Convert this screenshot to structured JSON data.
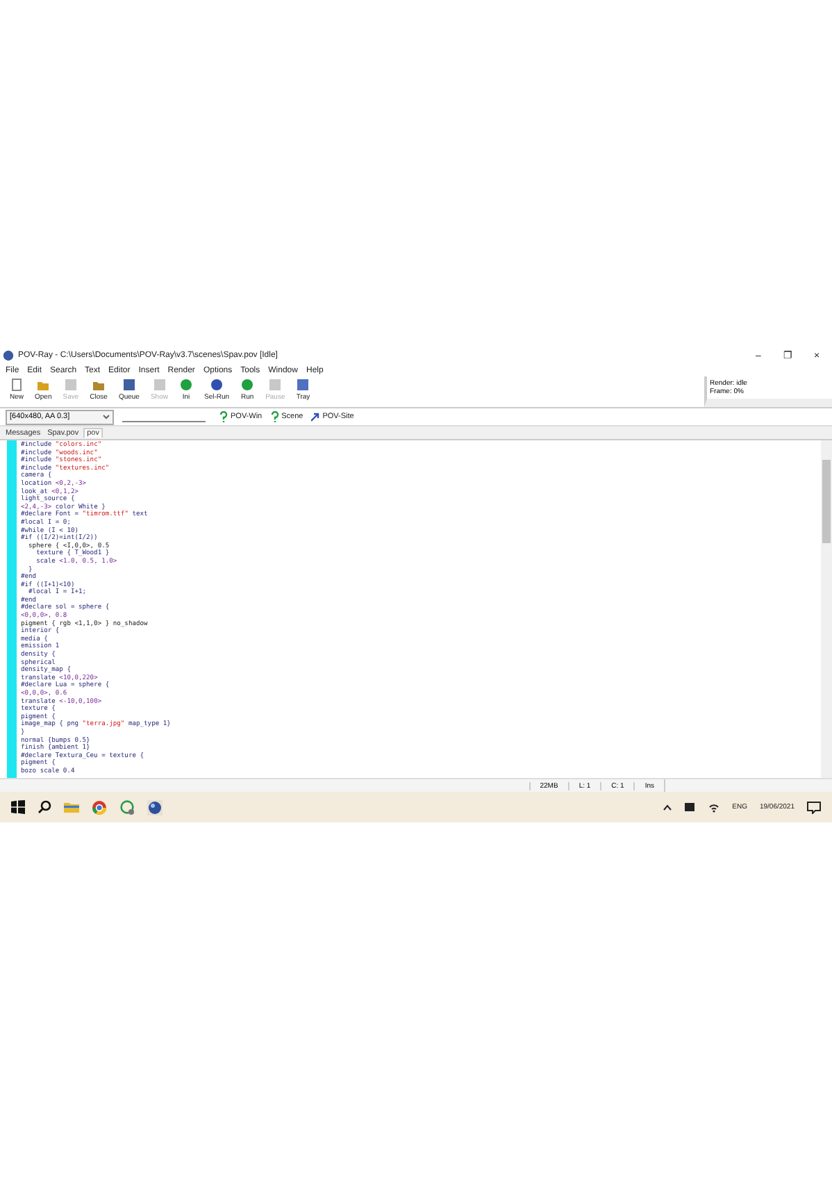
{
  "window": {
    "title": "POV-Ray - C:\\Users\\Documents\\POV-Ray\\v3.7\\scenes\\Spav.pov [Idle]",
    "controls": [
      "–",
      "❐",
      "×"
    ]
  },
  "menu": [
    "File",
    "Edit",
    "Search",
    "Text",
    "Editor",
    "Insert",
    "Render",
    "Options",
    "Tools",
    "Window",
    "Help"
  ],
  "toolbar": [
    {
      "label": "New",
      "kind": "new",
      "disabled": false
    },
    {
      "label": "Open",
      "kind": "open",
      "disabled": false
    },
    {
      "label": "Save",
      "kind": "save",
      "disabled": true
    },
    {
      "label": "Close",
      "kind": "close",
      "disabled": false
    },
    {
      "label": "Queue",
      "kind": "queue",
      "disabled": false
    },
    {
      "label": "Show",
      "kind": "show",
      "disabled": true
    },
    {
      "label": "Ini",
      "kind": "ini",
      "disabled": false
    },
    {
      "label": "Sel-Run",
      "kind": "selrun",
      "disabled": false
    },
    {
      "label": "Run",
      "kind": "run",
      "disabled": false
    },
    {
      "label": "Pause",
      "kind": "pause",
      "disabled": true
    },
    {
      "label": "Tray",
      "kind": "tray",
      "disabled": false
    }
  ],
  "status_panel": [
    "Render: idle",
    "Frame: 0%"
  ],
  "resolution": {
    "value": "[640x480, AA 0.3]"
  },
  "help_links": [
    {
      "label": "POV-Win",
      "kind": "question"
    },
    {
      "label": "Scene",
      "kind": "question"
    },
    {
      "label": "POV-Site",
      "kind": "link"
    }
  ],
  "tabs": [
    {
      "label": "Messages",
      "selected": false
    },
    {
      "label": "Spav.pov",
      "selected": false
    },
    {
      "label": "pov",
      "selected": true
    }
  ],
  "code": [
    [
      {
        "t": "#include ",
        "kind": "kw"
      },
      {
        "t": "\"colors.inc\"",
        "kind": "str"
      }
    ],
    [
      {
        "t": "#include ",
        "kind": "kw"
      },
      {
        "t": "\"woods.inc\"",
        "kind": "str"
      }
    ],
    [
      {
        "t": "#include ",
        "kind": "kw"
      },
      {
        "t": "\"stones.inc\"",
        "kind": "str"
      }
    ],
    [
      {
        "t": "#include ",
        "kind": "kw"
      },
      {
        "t": "\"textures.inc\"",
        "kind": "str"
      }
    ],
    [
      {
        "t": "camera {",
        "kind": "kw"
      }
    ],
    [
      {
        "t": "location ",
        "kind": "kw"
      },
      {
        "t": "<0,2,-3>",
        "kind": "num"
      }
    ],
    [
      {
        "t": "look_at ",
        "kind": "kw"
      },
      {
        "t": "<0,1,2>",
        "kind": "num"
      }
    ],
    [
      {
        "t": "light_source {",
        "kind": "kw"
      }
    ],
    [
      {
        "t": "<2,4,-3> ",
        "kind": "num"
      },
      {
        "t": "color White }",
        "kind": "kw"
      }
    ],
    [
      {
        "t": "#declare Font = ",
        "kind": "kw"
      },
      {
        "t": "\"timrom.ttf\"",
        "kind": "str"
      },
      {
        "t": " text",
        "kind": "kw"
      }
    ],
    [
      {
        "t": "#local I = 0;",
        "kind": "kw"
      }
    ],
    [
      {
        "t": "#while (I < 10)",
        "kind": "kw"
      }
    ],
    [
      {
        "t": "#if ((I/2)=int(I/2))",
        "kind": "kw"
      }
    ],
    [
      {
        "t": "  sphere { <I,0,0>, 0.5",
        "kind": "plain"
      }
    ],
    [
      {
        "t": "    texture { T_Wood1 }",
        "kind": "kw"
      }
    ],
    [
      {
        "t": "    scale ",
        "kind": "kw"
      },
      {
        "t": "<1.0, 0.5, 1.0>",
        "kind": "num"
      }
    ],
    [
      {
        "t": "  }",
        "kind": "kw"
      }
    ],
    [
      {
        "t": "#end",
        "kind": "kw"
      }
    ],
    [
      {
        "t": "#if ((I+1)<10)",
        "kind": "kw"
      }
    ],
    [
      {
        "t": "  #local I = I+1;",
        "kind": "kw"
      }
    ],
    [
      {
        "t": "#end",
        "kind": "kw"
      }
    ],
    [
      {
        "t": "#declare sol = sphere {",
        "kind": "kw"
      }
    ],
    [
      {
        "t": "<0,0,0>, 0.8",
        "kind": "num"
      }
    ],
    [
      {
        "t": "pigment { rgb <1,1,0> } no_shadow",
        "kind": "plain"
      }
    ],
    [
      {
        "t": "interior {",
        "kind": "kw"
      }
    ],
    [
      {
        "t": "media {",
        "kind": "kw"
      }
    ],
    [
      {
        "t": "emission 1",
        "kind": "kw"
      }
    ],
    [
      {
        "t": "density {",
        "kind": "kw"
      }
    ],
    [
      {
        "t": "spherical",
        "kind": "kw"
      }
    ],
    [
      {
        "t": "density_map {",
        "kind": "kw"
      }
    ],
    [
      {
        "t": "translate ",
        "kind": "kw"
      },
      {
        "t": "<10,0,220>",
        "kind": "num"
      }
    ],
    [
      {
        "t": "#declare Lua = sphere {",
        "kind": "kw"
      }
    ],
    [
      {
        "t": "<0,0,0>, 0.6",
        "kind": "num"
      }
    ],
    [
      {
        "t": "translate ",
        "kind": "kw"
      },
      {
        "t": "<-10,0,100>",
        "kind": "num"
      }
    ],
    [
      {
        "t": "texture {",
        "kind": "kw"
      }
    ],
    [
      {
        "t": "pigment {",
        "kind": "kw"
      }
    ],
    [
      {
        "t": "image_map { png ",
        "kind": "kw"
      },
      {
        "t": "\"terra.jpg\"",
        "kind": "str"
      },
      {
        "t": " map_type 1}",
        "kind": "kw"
      }
    ],
    [
      {
        "t": "}",
        "kind": "kw"
      }
    ],
    [
      {
        "t": "normal {bumps 0.5}",
        "kind": "kw"
      }
    ],
    [
      {
        "t": "finish {ambient 1}",
        "kind": "kw"
      }
    ],
    [
      {
        "t": "#declare Textura_Ceu = texture {",
        "kind": "kw"
      }
    ],
    [
      {
        "t": "pigment {",
        "kind": "kw"
      }
    ],
    [
      {
        "t": "bozo scale 0.4",
        "kind": "kw"
      }
    ]
  ],
  "status_bar": [
    "22MB",
    "L: 1",
    "C: 1",
    "Ins"
  ],
  "taskbar": {
    "tray_text": [
      "ENG",
      "19/06/2021"
    ]
  }
}
